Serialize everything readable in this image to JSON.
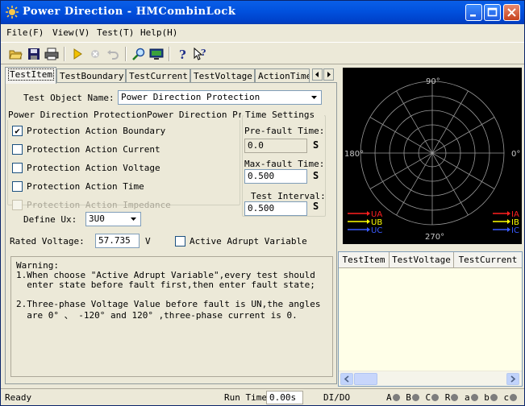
{
  "window": {
    "title": "Power Direction - HMCombinLock"
  },
  "menu": [
    "File(F)",
    "View(V)",
    "Test(T)",
    "Help(H)"
  ],
  "toolbar": {
    "icons": [
      "open-folder-icon",
      "save-icon",
      "print-icon",
      "play-icon",
      "stop-icon",
      "undo-icon",
      "zoom-icon",
      "monitor-icon",
      "help-icon",
      "context-help-icon"
    ]
  },
  "tabs": [
    "TestItem",
    "TestBoundary",
    "TestCurrent",
    "TestVoltage",
    "ActionTime"
  ],
  "form": {
    "test_object_label": "Test Object Name:",
    "test_object_value": "Power Direction Protection",
    "group_title": "Power Direction ProtectionPower Direction Protc",
    "checks": [
      {
        "label": "Protection Action Boundary",
        "checked": true,
        "enabled": true
      },
      {
        "label": "Protection Action Current",
        "checked": false,
        "enabled": true
      },
      {
        "label": "Protection Action Voltage",
        "checked": false,
        "enabled": true
      },
      {
        "label": "Protection Action Time",
        "checked": false,
        "enabled": true
      },
      {
        "label": "Protection Action Impedance",
        "checked": false,
        "enabled": false
      }
    ],
    "define_ux_label": "Define Ux:",
    "define_ux_value": "3U0",
    "rated_voltage_label": "Rated Voltage:",
    "rated_voltage_value": "57.735",
    "rated_voltage_unit": "V",
    "active_adrupt_label": "Active Adrupt Variable"
  },
  "time_settings": {
    "title": "Time Settings",
    "prefault_label": "Pre-fault Time:",
    "prefault_value": "0.0",
    "maxfault_label": "Max-fault Time:",
    "maxfault_value": "0.500",
    "interval_label": "Test Interval:",
    "interval_value": "0.500",
    "unit": "S"
  },
  "warning": {
    "title": "Warning:",
    "lines": [
      "1.When choose \"Active Adrupt Variable\",every test should",
      "  enter state before fault first,then enter fault state;",
      "",
      "2.Three-phase Voltage Value before fault is UN,the angles",
      "  are 0° 、 -120° and 120° ,three-phase current is 0."
    ]
  },
  "polar": {
    "angle_labels": {
      "top": "90°",
      "bottom": "270°",
      "left": "180°",
      "right": "0°"
    },
    "left_legend": [
      "UA",
      "UB",
      "UC"
    ],
    "right_legend": [
      "IA",
      "IB",
      "IC"
    ],
    "colors": {
      "A": "#FF2020",
      "B": "#FFFF00",
      "C": "#3A5BFF",
      "grid": "#9A9A9A",
      "background": "#000000"
    }
  },
  "results_table": {
    "columns": [
      "TestItem",
      "TestVoltage",
      "TestCurrent"
    ]
  },
  "status": {
    "ready": "Ready",
    "run_time_label": "Run Time",
    "run_time_value": "0.00s",
    "dido_label": "DI/DO",
    "leds": [
      "A",
      "B",
      "C",
      "R",
      "a",
      "b",
      "c"
    ]
  }
}
